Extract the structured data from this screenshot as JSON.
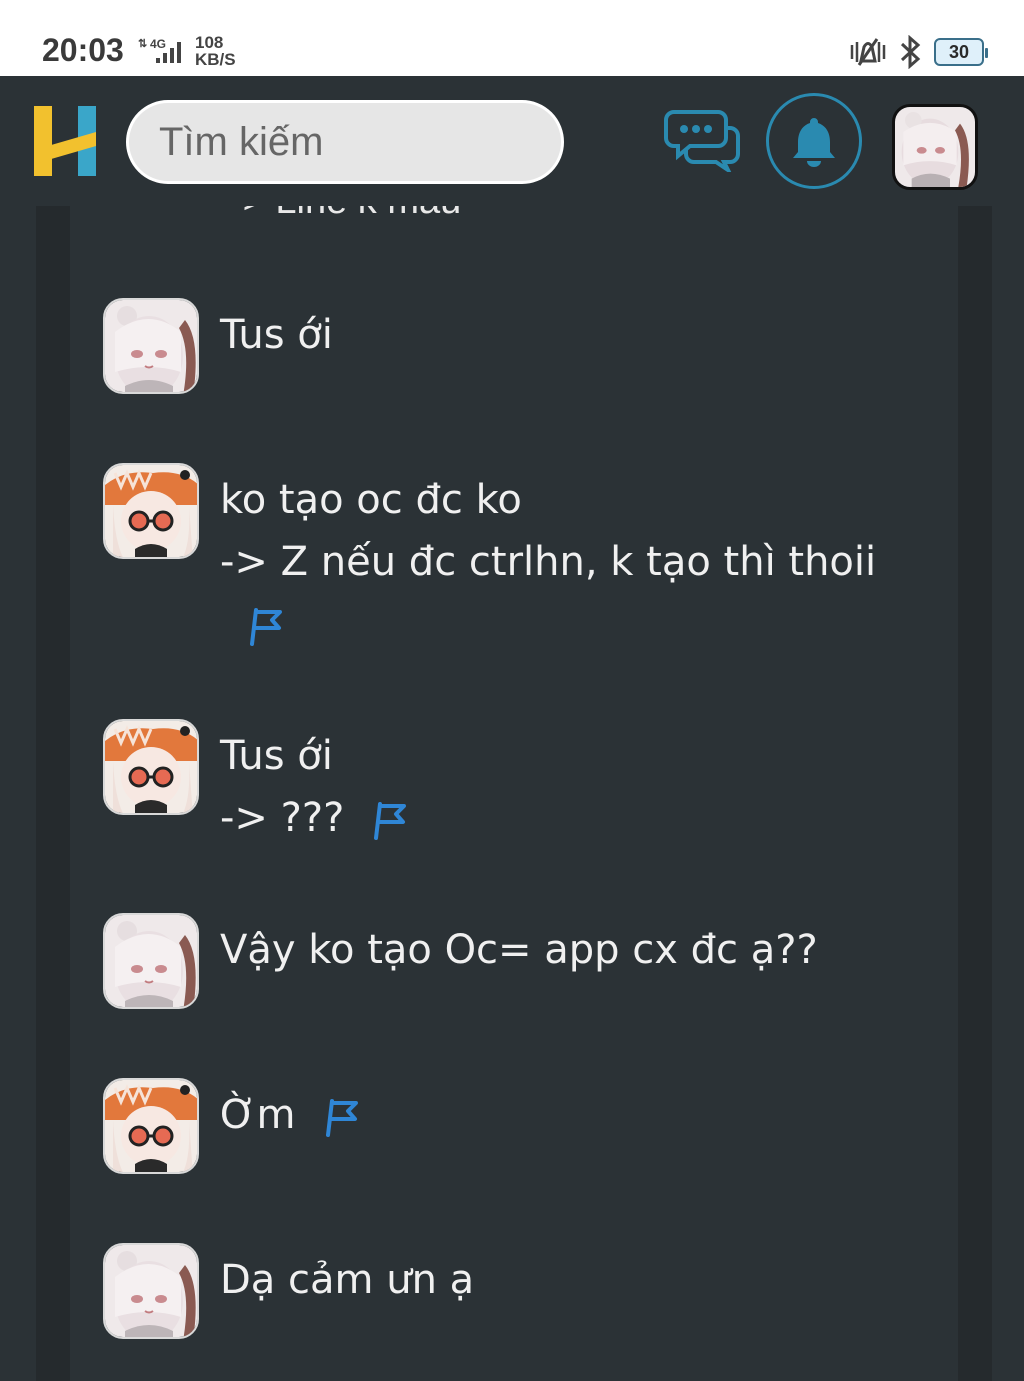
{
  "status_bar": {
    "time": "20:03",
    "network": "4G",
    "speed_value": "108",
    "speed_unit": "KB/S",
    "battery": "30"
  },
  "header": {
    "logo_letter": "H",
    "search_placeholder": "Tìm kiếm",
    "icons": [
      "chat-icon",
      "bell-icon",
      "avatar"
    ]
  },
  "colors": {
    "background": "#2b3236",
    "accent": "#2a8ab0",
    "flag": "#2f86d6",
    "logo_yellow": "#f2c12e",
    "logo_blue": "#3aa6c9"
  },
  "thread": {
    "cut_off_text": "-> Line k màu",
    "comments": [
      {
        "avatar": "avatar-pink",
        "lines": [
          "Tus ới"
        ],
        "flag": false
      },
      {
        "avatar": "avatar-orange",
        "lines": [
          "ko tạo oc đc ko",
          "-> Z nếu đc ctrlhn, k tạo thì thoii"
        ],
        "flag": true
      },
      {
        "avatar": "avatar-orange",
        "lines": [
          "Tus ới",
          "-> ???"
        ],
        "flag": true
      },
      {
        "avatar": "avatar-pink",
        "lines": [
          "Vậy ko tạo Oc= app cx đc ạ??"
        ],
        "flag": false
      },
      {
        "avatar": "avatar-orange",
        "lines": [
          "Ờm"
        ],
        "flag": true
      },
      {
        "avatar": "avatar-pink",
        "lines": [
          "Dạ cảm ưn ạ"
        ],
        "flag": false
      }
    ]
  }
}
